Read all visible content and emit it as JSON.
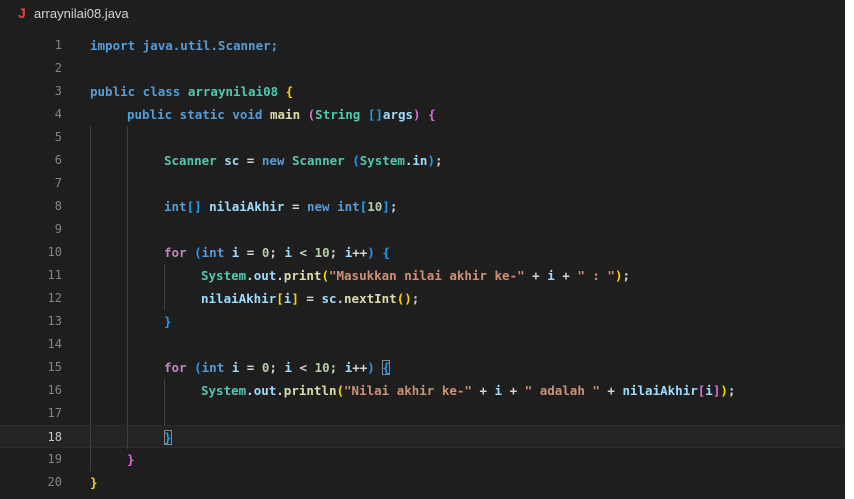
{
  "editor": {
    "tab": {
      "icon": "java-file-icon",
      "icon_glyph": "J",
      "filename": "arraynilai08.java"
    },
    "current_line": 18,
    "lines": [
      {
        "number": "1",
        "tokens": [
          {
            "t": "import java.util.Scanner;",
            "c": "kw-import"
          }
        ]
      },
      {
        "number": "2",
        "tokens": []
      },
      {
        "number": "3",
        "tokens": [
          {
            "t": "public class ",
            "c": "kw"
          },
          {
            "t": "arraynilai08",
            "c": "type"
          },
          {
            "t": " {",
            "c": "p1"
          }
        ]
      },
      {
        "number": "4",
        "tokens": [
          {
            "t": "public static void ",
            "c": "kw"
          },
          {
            "t": "main",
            "c": "fn"
          },
          {
            "t": " (",
            "c": "p2"
          },
          {
            "t": "String ",
            "c": "type"
          },
          {
            "t": "[]",
            "c": "p3"
          },
          {
            "t": "args",
            "c": "var"
          },
          {
            "t": ")",
            "c": "p2"
          },
          {
            "t": " {",
            "c": "p2"
          }
        ]
      },
      {
        "number": "5",
        "tokens": []
      },
      {
        "number": "6",
        "tokens": [
          {
            "t": "Scanner ",
            "c": "type"
          },
          {
            "t": "sc",
            "c": "var"
          },
          {
            "t": " = ",
            "c": "plain"
          },
          {
            "t": "new ",
            "c": "kw"
          },
          {
            "t": "Scanner ",
            "c": "type"
          },
          {
            "t": "(",
            "c": "p3"
          },
          {
            "t": "System",
            "c": "type"
          },
          {
            "t": ".",
            "c": "plain"
          },
          {
            "t": "in",
            "c": "var"
          },
          {
            "t": ")",
            "c": "p3"
          },
          {
            "t": ";",
            "c": "plain"
          }
        ]
      },
      {
        "number": "7",
        "tokens": []
      },
      {
        "number": "8",
        "tokens": [
          {
            "t": "int",
            "c": "kw"
          },
          {
            "t": "[] ",
            "c": "p3"
          },
          {
            "t": "nilaiAkhir",
            "c": "var"
          },
          {
            "t": " = ",
            "c": "plain"
          },
          {
            "t": "new ",
            "c": "kw"
          },
          {
            "t": "int",
            "c": "kw"
          },
          {
            "t": "[",
            "c": "p3"
          },
          {
            "t": "10",
            "c": "num"
          },
          {
            "t": "]",
            "c": "p3"
          },
          {
            "t": ";",
            "c": "plain"
          }
        ]
      },
      {
        "number": "9",
        "tokens": []
      },
      {
        "number": "10",
        "tokens": [
          {
            "t": "for ",
            "c": "ctrl"
          },
          {
            "t": "(",
            "c": "p3"
          },
          {
            "t": "int ",
            "c": "kw"
          },
          {
            "t": "i",
            "c": "var"
          },
          {
            "t": " = ",
            "c": "plain"
          },
          {
            "t": "0",
            "c": "num"
          },
          {
            "t": "; ",
            "c": "plain"
          },
          {
            "t": "i",
            "c": "var"
          },
          {
            "t": " < ",
            "c": "plain"
          },
          {
            "t": "10",
            "c": "num"
          },
          {
            "t": "; ",
            "c": "plain"
          },
          {
            "t": "i",
            "c": "var"
          },
          {
            "t": "++",
            "c": "plain"
          },
          {
            "t": ")",
            "c": "p3"
          },
          {
            "t": " {",
            "c": "p3"
          }
        ]
      },
      {
        "number": "11",
        "tokens": [
          {
            "t": "System",
            "c": "type"
          },
          {
            "t": ".",
            "c": "plain"
          },
          {
            "t": "out",
            "c": "var"
          },
          {
            "t": ".",
            "c": "plain"
          },
          {
            "t": "print",
            "c": "fn"
          },
          {
            "t": "(",
            "c": "p1"
          },
          {
            "t": "\"Masukkan nilai akhir ke-\"",
            "c": "str"
          },
          {
            "t": " + ",
            "c": "plain"
          },
          {
            "t": "i",
            "c": "var"
          },
          {
            "t": " + ",
            "c": "plain"
          },
          {
            "t": "\" : \"",
            "c": "str"
          },
          {
            "t": ")",
            "c": "p1"
          },
          {
            "t": ";",
            "c": "plain"
          }
        ]
      },
      {
        "number": "12",
        "tokens": [
          {
            "t": "nilaiAkhir",
            "c": "var"
          },
          {
            "t": "[",
            "c": "p1"
          },
          {
            "t": "i",
            "c": "var"
          },
          {
            "t": "]",
            "c": "p1"
          },
          {
            "t": " = ",
            "c": "plain"
          },
          {
            "t": "sc",
            "c": "var"
          },
          {
            "t": ".",
            "c": "plain"
          },
          {
            "t": "nextInt",
            "c": "fn"
          },
          {
            "t": "()",
            "c": "p1"
          },
          {
            "t": ";",
            "c": "plain"
          }
        ]
      },
      {
        "number": "13",
        "tokens": [
          {
            "t": "}",
            "c": "p3"
          }
        ]
      },
      {
        "number": "14",
        "tokens": []
      },
      {
        "number": "15",
        "tokens": [
          {
            "t": "for ",
            "c": "ctrl"
          },
          {
            "t": "(",
            "c": "p3"
          },
          {
            "t": "int ",
            "c": "kw"
          },
          {
            "t": "i",
            "c": "var"
          },
          {
            "t": " = ",
            "c": "plain"
          },
          {
            "t": "0",
            "c": "num"
          },
          {
            "t": "; ",
            "c": "plain"
          },
          {
            "t": "i",
            "c": "var"
          },
          {
            "t": " < ",
            "c": "plain"
          },
          {
            "t": "10",
            "c": "num"
          },
          {
            "t": "; ",
            "c": "plain"
          },
          {
            "t": "i",
            "c": "var"
          },
          {
            "t": "++",
            "c": "plain"
          },
          {
            "t": ") ",
            "c": "p3"
          },
          {
            "t": "{",
            "c": "p3m"
          }
        ]
      },
      {
        "number": "16",
        "tokens": [
          {
            "t": "System",
            "c": "type"
          },
          {
            "t": ".",
            "c": "plain"
          },
          {
            "t": "out",
            "c": "var"
          },
          {
            "t": ".",
            "c": "plain"
          },
          {
            "t": "println",
            "c": "fn"
          },
          {
            "t": "(",
            "c": "p1"
          },
          {
            "t": "\"Nilai akhir ke-\"",
            "c": "str"
          },
          {
            "t": " + ",
            "c": "plain"
          },
          {
            "t": "i",
            "c": "var"
          },
          {
            "t": " + ",
            "c": "plain"
          },
          {
            "t": "\" adalah \"",
            "c": "str"
          },
          {
            "t": " + ",
            "c": "plain"
          },
          {
            "t": "nilaiAkhir",
            "c": "var"
          },
          {
            "t": "[",
            "c": "p2"
          },
          {
            "t": "i",
            "c": "var"
          },
          {
            "t": "]",
            "c": "p2"
          },
          {
            "t": ")",
            "c": "p1"
          },
          {
            "t": ";",
            "c": "plain"
          }
        ]
      },
      {
        "number": "17",
        "tokens": []
      },
      {
        "number": "18",
        "tokens": [
          {
            "t": "}",
            "c": "p3m"
          }
        ]
      },
      {
        "number": "19",
        "tokens": [
          {
            "t": "}",
            "c": "p2"
          }
        ]
      },
      {
        "number": "20",
        "tokens": [
          {
            "t": "}",
            "c": "p1"
          }
        ]
      }
    ]
  }
}
